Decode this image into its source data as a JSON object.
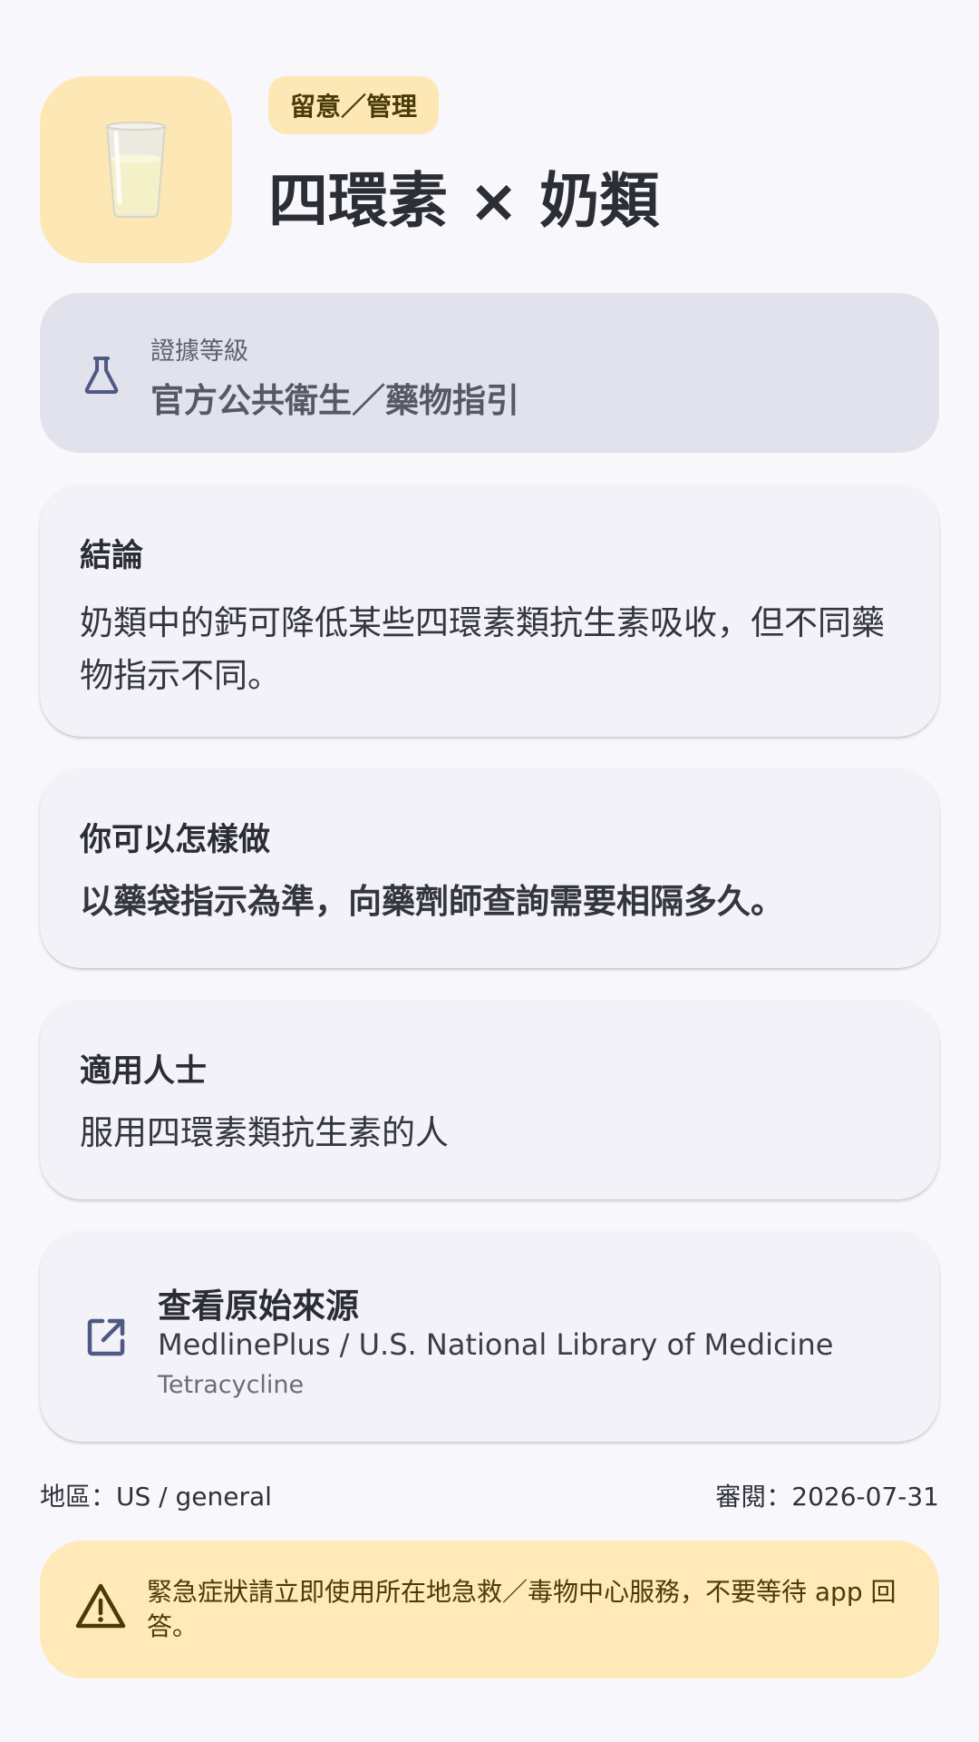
{
  "header": {
    "food_icon": "milk-glass-icon",
    "status_chip": "留意／管理",
    "title": "四環素 × 奶類"
  },
  "evidence": {
    "icon": "flask-icon",
    "label": "證據等級",
    "value": "官方公共衛生／藥物指引"
  },
  "conclusion": {
    "heading": "結論",
    "body": "奶類中的鈣可降低某些四環素類抗生素吸收，但不同藥物指示不同。"
  },
  "action": {
    "heading": "你可以怎樣做",
    "body": "以藥袋指示為準，向藥劑師查詢需要相隔多久。"
  },
  "audience": {
    "heading": "適用人士",
    "body": "服用四環素類抗生素的人"
  },
  "source": {
    "icon": "open-in-new-icon",
    "heading": "查看原始來源",
    "name": "MedlinePlus / U.S. National Library of Medicine",
    "detail": "Tetracycline"
  },
  "meta": {
    "region": "地區：US / general",
    "reviewed": "審閱：2026-07-31"
  },
  "warning": {
    "icon": "warning-triangle-icon",
    "text": "緊急症狀請立即使用所在地急救／毒物中心服務，不要等待 app 回答。"
  },
  "colors": {
    "background": "#f8f7fc",
    "chip_background": "#fde8b5",
    "evidence_background": "#e2e2ec",
    "card_background": "#f3f2f8",
    "warning_background": "#ffe9b8",
    "accent_icon": "#4f5a84"
  }
}
